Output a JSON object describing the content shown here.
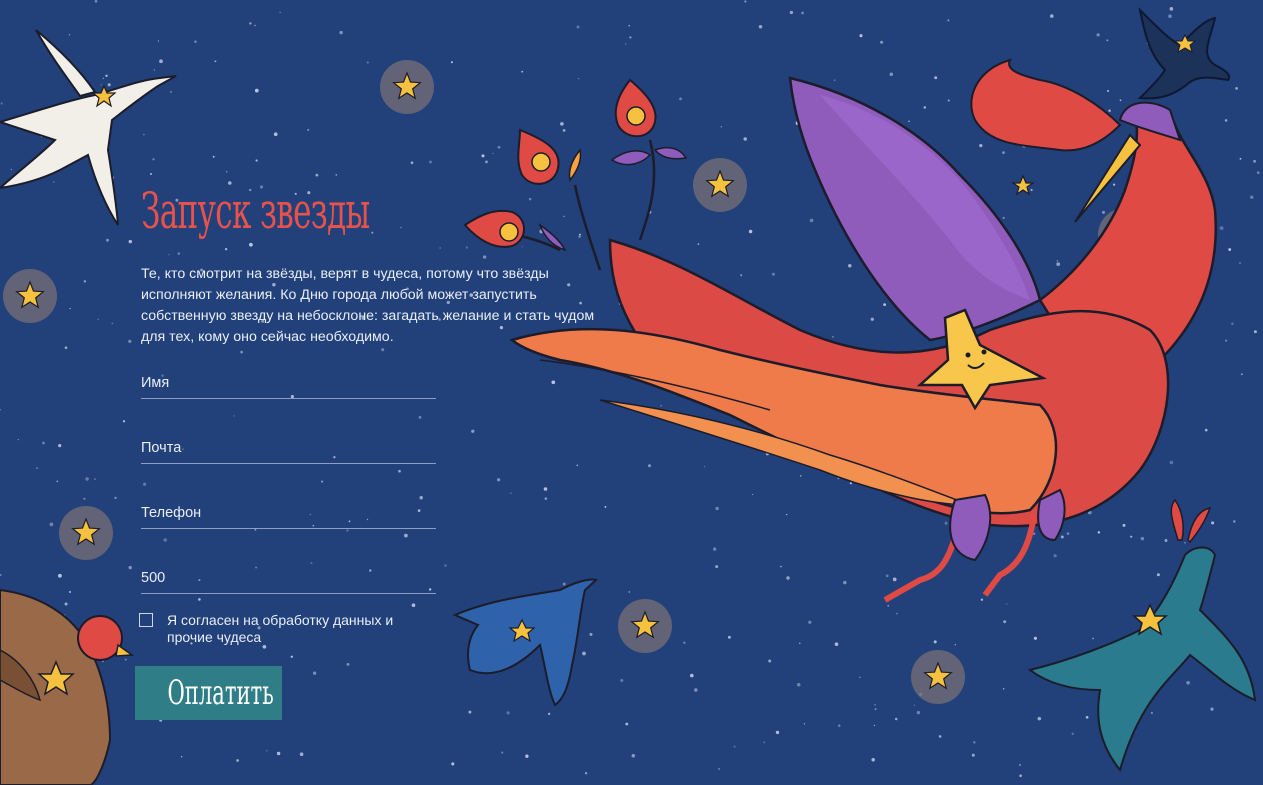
{
  "page": {
    "title": "Запуск звезды",
    "description": "Те, кто смотрит на звёзды, верят в чудеса, потому что звёзды исполняют желания. Ко Дню города любой может запустить собственную звезду на небосклоне: загадать желание и стать чудом для тех, кому оно сейчас необходимо."
  },
  "form": {
    "name_placeholder": "Имя",
    "email_placeholder": "Почта",
    "phone_placeholder": "Телефон",
    "amount_value": "500",
    "consent_label": "Я согласен на обработку данных и прочие чудеса",
    "consent_checked": false,
    "pay_label": "Оплатить"
  },
  "colors": {
    "background": "#22407a",
    "title": "#e8524b",
    "button": "#2f7d86",
    "text": "#e9eef7"
  }
}
